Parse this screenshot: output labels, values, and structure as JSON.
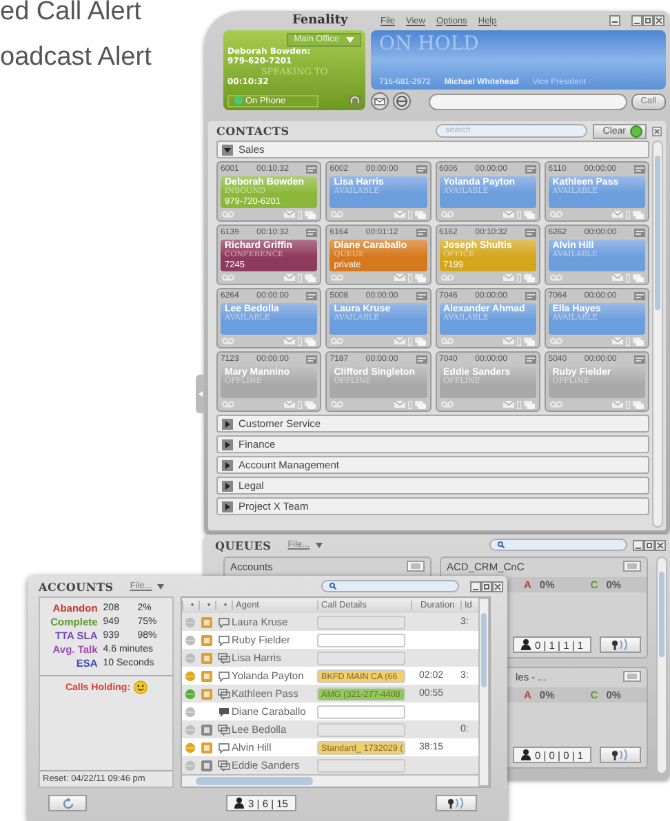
{
  "background_texts": [
    "ed Call Alert",
    "oadcast Alert"
  ],
  "main_window": {
    "title": "Fenality",
    "menu": [
      "File",
      "View",
      "Options",
      "Help"
    ],
    "current_call": {
      "location": "Main Office",
      "caller": "Deborah Bowden:",
      "number": "979-620-7201",
      "state": "SPEAKING TO",
      "timer": "00:10:32",
      "status": "On Phone"
    },
    "hold": {
      "state": "ON HOLD",
      "number": "716-681-2972",
      "name": "Michael Whitehead",
      "role": "Vice President"
    },
    "dial": {
      "button": "Call"
    }
  },
  "contacts": {
    "title": "CONTACTS",
    "search": {
      "placeholder": "search"
    },
    "clear_button": "Clear",
    "groups": [
      {
        "name": "Sales",
        "expanded": true,
        "cards": [
          {
            "ext": "6001",
            "time": "00:10:32",
            "name": "Deborah Bowden",
            "status": "INBOUND",
            "detail": "979-720-6201",
            "color": "#8cb83a"
          },
          {
            "ext": "6002",
            "time": "00:00:00",
            "name": "Lisa Harris",
            "status": "AVAILABLE",
            "color": "#6c9ddc"
          },
          {
            "ext": "6006",
            "time": "00:00:00",
            "name": "Yolanda Payton",
            "status": "AVAILABLE",
            "color": "#6c9ddc"
          },
          {
            "ext": "6110",
            "time": "00:00:00",
            "name": "Kathleen Pass",
            "status": "AVAILABLE",
            "color": "#6c9ddc"
          },
          {
            "ext": "6139",
            "time": "00:10:32",
            "name": "Richard Griffin",
            "status": "CONFERENCE",
            "detail": "7245",
            "color": "#8e3a5c"
          },
          {
            "ext": "6164",
            "time": "00:01:12",
            "name": "Diane Caraballo",
            "status": "QUEUE",
            "detail": "private",
            "color": "#d5781e"
          },
          {
            "ext": "6162",
            "time": "00:10:32",
            "name": "Joseph Shultis",
            "status": "OFFICE",
            "detail": "7199",
            "color": "#d4a61c"
          },
          {
            "ext": "6262",
            "time": "00:00:00",
            "name": "Alvin Hill",
            "status": "AVAILABLE",
            "color": "#6c9ddc"
          },
          {
            "ext": "6264",
            "time": "00:00:00",
            "name": "Lee Bedolla",
            "status": "AVAILABLE",
            "color": "#6c9ddc"
          },
          {
            "ext": "5008",
            "time": "00:00:00",
            "name": "Laura Kruse",
            "status": "AVAILABLE",
            "color": "#6c9ddc"
          },
          {
            "ext": "7046",
            "time": "00:00:00",
            "name": "Alexander Ahmad",
            "status": "AVAILABLE",
            "color": "#6c9ddc"
          },
          {
            "ext": "7064",
            "time": "00:00:00",
            "name": "Ella Hayes",
            "status": "AVAILABLE",
            "color": "#6c9ddc"
          },
          {
            "ext": "7123",
            "time": "00:00:00",
            "name": "Mary Mannino",
            "status": "OFFLINE",
            "color": "#a9a9a9"
          },
          {
            "ext": "7187",
            "time": "00:00:00",
            "name": "Clifford Singleton",
            "status": "OFFLINE",
            "color": "#a9a9a9"
          },
          {
            "ext": "7040",
            "time": "00:00:00",
            "name": "Eddie Sanders",
            "status": "OFFLINE",
            "color": "#a9a9a9"
          },
          {
            "ext": "5040",
            "time": "00:00:00",
            "name": "Ruby Fielder",
            "status": "OFFLINE",
            "color": "#a9a9a9"
          }
        ]
      },
      {
        "name": "Customer Service",
        "expanded": false
      },
      {
        "name": "Finance",
        "expanded": false
      },
      {
        "name": "Account Management",
        "expanded": false
      },
      {
        "name": "Legal",
        "expanded": false
      },
      {
        "name": "Project X Team",
        "expanded": false
      }
    ]
  },
  "queues": {
    "title": "QUEUES",
    "menu": "File...",
    "panels": [
      {
        "name": "Accounts"
      },
      {
        "name": "ACD_CRM_CnC",
        "abandon_label": "A",
        "abandon": "0%",
        "complete_label": "C",
        "complete": "0%",
        "counts": "0 | 1 | 1 | 1"
      },
      {
        "name": "les - ...",
        "abandon_label": "A",
        "abandon": "0%",
        "complete_label": "C",
        "complete": "0%",
        "counts": "0 | 0 | 0 | 1"
      }
    ]
  },
  "accounts": {
    "title": "ACCOUNTS",
    "menu": "File...",
    "stats": [
      {
        "label": "Abandon",
        "count": "208",
        "percent": "2%",
        "color": "#c0392b"
      },
      {
        "label": "Complete",
        "count": "949",
        "percent": "75%",
        "color": "#5a9a2a"
      },
      {
        "label": "TTA SLA",
        "count": "939",
        "percent": "98%",
        "color": "#7046b0"
      },
      {
        "label": "Avg. Talk",
        "value": "4.6 minutes",
        "color": "#a04ab4"
      },
      {
        "label": "ESA",
        "value": "10 Seconds",
        "color": "#3a48b0"
      }
    ],
    "holding_label": "Calls Holding:",
    "reset": "Reset: 04/22/11 09:46 pm",
    "columns": [
      "•",
      "•",
      "•",
      "Agent",
      "Call Details",
      "Duration",
      "Id"
    ],
    "rows": [
      {
        "agent": "Laura Kruse",
        "color": "#bdbdbd",
        "device_active": true,
        "kind": "single",
        "id": "3:"
      },
      {
        "agent": "Ruby Fielder",
        "color": "#bdbdbd",
        "device_active": true,
        "kind": "single"
      },
      {
        "agent": "Lisa Harris",
        "color": "#bdbdbd",
        "device_active": true,
        "kind": "double"
      },
      {
        "agent": "Yolanda Payton",
        "color": "#e0a91c",
        "device_active": true,
        "kind": "single",
        "call": {
          "details": "BKFD MAIN  CA (66",
          "color": "#f2cf6a"
        },
        "duration": "02:02",
        "id": "3:"
      },
      {
        "agent": "Kathleen Pass",
        "color": "#5aae3a",
        "device_active": true,
        "kind": "double",
        "call": {
          "details": "AMG (321-277-4408",
          "color": "#8ccc5a"
        },
        "duration": "00:55"
      },
      {
        "agent": "Diane Caraballo",
        "color": "#bdbdbd",
        "kind": "busy"
      },
      {
        "agent": "Lee Bedolla",
        "color": "#bdbdbd",
        "device_active": false,
        "kind": "double",
        "id": "0:"
      },
      {
        "agent": "Alvin Hill",
        "color": "#e0a91c",
        "device_active": true,
        "kind": "single",
        "call": {
          "details": "Standard_ 1732029 (",
          "color": "#f2cf6a"
        },
        "duration": "38:15"
      },
      {
        "agent": "Eddie Sanders",
        "color": "#bdbdbd",
        "device_active": false,
        "kind": "double"
      }
    ],
    "counts": "3 | 6 | 15"
  }
}
